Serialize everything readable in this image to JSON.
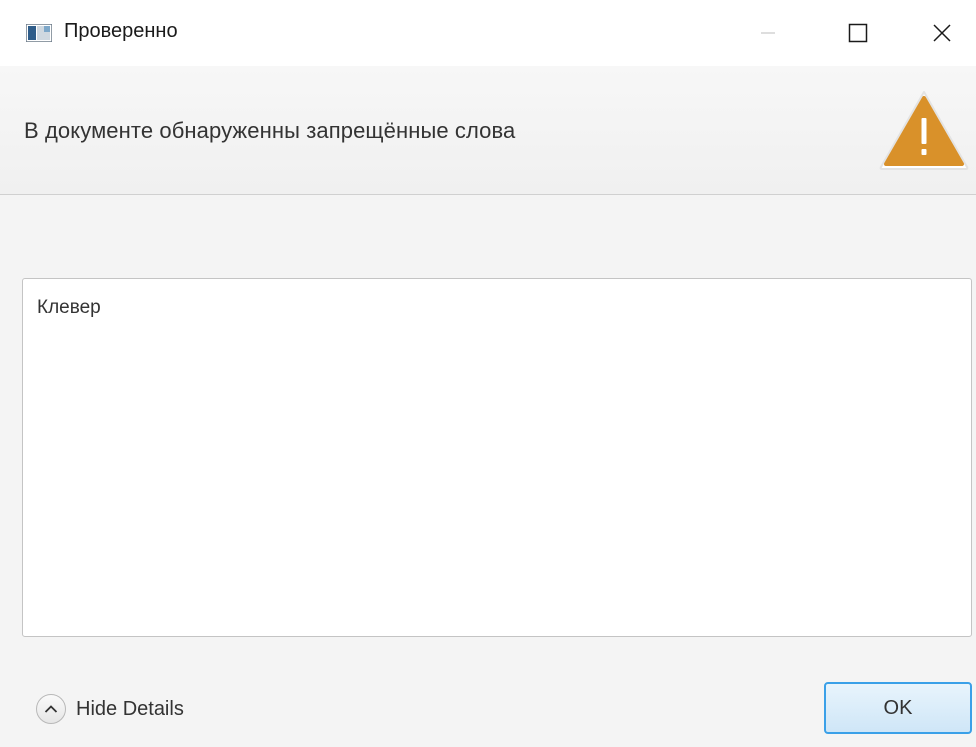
{
  "window": {
    "title": "Проверенно"
  },
  "header": {
    "message": "В документе обнаруженны запрещённые слова",
    "icon": "warning-icon",
    "icon_color": "#d9912a"
  },
  "details": {
    "content": "Клевер"
  },
  "footer": {
    "hide_details_label": "Hide Details",
    "ok_label": "OK"
  },
  "colors": {
    "ok_border": "#3aa0e8",
    "background": "#f4f4f4"
  }
}
